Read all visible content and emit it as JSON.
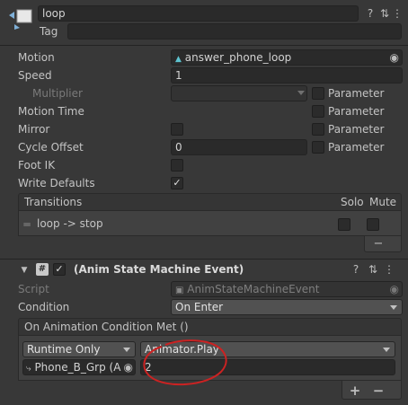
{
  "state": {
    "name": "loop",
    "tag_label": "Tag",
    "tag_value": ""
  },
  "props": {
    "motion_label": "Motion",
    "motion_value": "answer_phone_loop",
    "speed_label": "Speed",
    "speed_value": "1",
    "multiplier_label": "Multiplier",
    "multiplier_value": "",
    "motion_time_label": "Motion Time",
    "mirror_label": "Mirror",
    "cycle_offset_label": "Cycle Offset",
    "cycle_offset_value": "0",
    "foot_ik_label": "Foot IK",
    "write_defaults_label": "Write Defaults",
    "parameter_label": "Parameter"
  },
  "transitions": {
    "header": "Transitions",
    "solo": "Solo",
    "mute": "Mute",
    "items": [
      {
        "label": "loop -> stop"
      }
    ]
  },
  "component": {
    "title": "(Anim State Machine Event)",
    "script_label": "Script",
    "script_value": "AnimStateMachineEvent",
    "condition_label": "Condition",
    "condition_value": "On Enter",
    "event_header": "On Animation Condition Met ()",
    "runtime_value": "Runtime Only",
    "function_value": "Animator.Play",
    "target_value": "Phone_B_Grp (A",
    "argument_value": "2"
  },
  "colors": {
    "accent": "#3d8bd4",
    "annotation": "#cc2222"
  }
}
